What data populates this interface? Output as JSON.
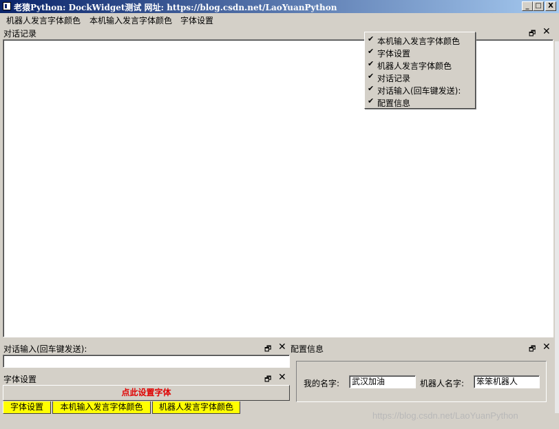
{
  "window": {
    "title": "老猿Python: DockWidget测试    网址: https://blog.csdn.net/LaoYuanPython"
  },
  "window_buttons": {
    "minimize": "_",
    "maximize": "□",
    "close": "X"
  },
  "menubar": {
    "items": [
      "机器人发言字体颜色",
      "本机输入发言字体颜色",
      "字体设置"
    ]
  },
  "dock_chat": {
    "title": "对话记录"
  },
  "context_menu": {
    "items": [
      {
        "label": "本机输入发言字体颜色",
        "checked": true
      },
      {
        "label": "字体设置",
        "checked": true
      },
      {
        "label": "机器人发言字体颜色",
        "checked": true
      },
      {
        "label": "对话记录",
        "checked": true
      },
      {
        "label": "对话输入(回车键发送):",
        "checked": true
      },
      {
        "label": "配置信息",
        "checked": true
      }
    ],
    "check_glyph": "✔"
  },
  "dock_input": {
    "title": "对话输入(回车键发送):",
    "value": ""
  },
  "dock_font": {
    "title": "字体设置",
    "button_label": "点此设置字体"
  },
  "tabs": [
    "字体设置",
    "本机输入发言字体颜色",
    "机器人发言字体颜色"
  ],
  "dock_config": {
    "title": "配置信息",
    "my_name_label": "我的名字:",
    "my_name_value": "武汉加油",
    "robot_name_label": "机器人名字:",
    "robot_name_value": "笨笨机器人"
  },
  "dock_controls": {
    "float_icon": "🗗",
    "close_icon": "✕"
  },
  "watermark": "https://blog.csdn.net/LaoYuanPython",
  "colors": {
    "button_text": "#e00000",
    "tab_highlight": "#ffff00",
    "titlebar": "#0a246a"
  }
}
